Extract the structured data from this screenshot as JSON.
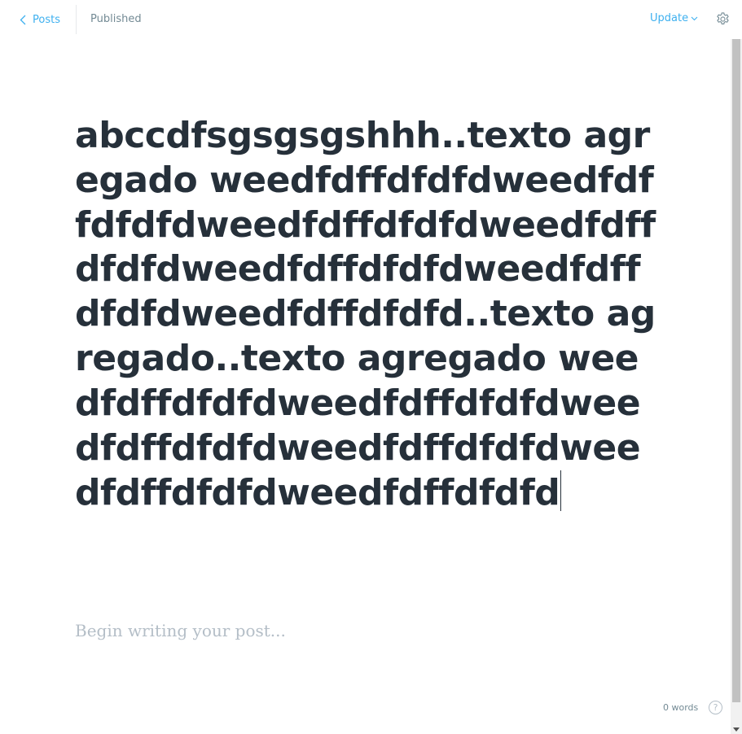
{
  "header": {
    "back_label": "Posts",
    "status": "Published",
    "update_label": "Update"
  },
  "editor": {
    "title": "abccdfsgsgsgshhh..texto agregado weedfdffdfdfdweedfdffdfdfdweedfdffdfdfdweedfdffdfdfdweedfdffdfdfdweedfdffdfdfdweedfdffdfdfd..texto agregado..texto agregado weedfdffdfdfdweedfdffdfdfdweedfdffdfdfdweedfdffdfdfdweedfdffdfdfdweedfdffdfdfd",
    "body_placeholder": "Begin writing your post..."
  },
  "footer": {
    "word_count": "0 words",
    "help_symbol": "?"
  },
  "icons": {
    "back": "chevron-left-icon",
    "update": "chevron-down-icon",
    "settings": "gear-icon",
    "help": "help-icon"
  },
  "colors": {
    "accent": "#3eb0ef",
    "text": "#26303a",
    "muted": "#738a94",
    "placeholder": "#b4bec7"
  }
}
